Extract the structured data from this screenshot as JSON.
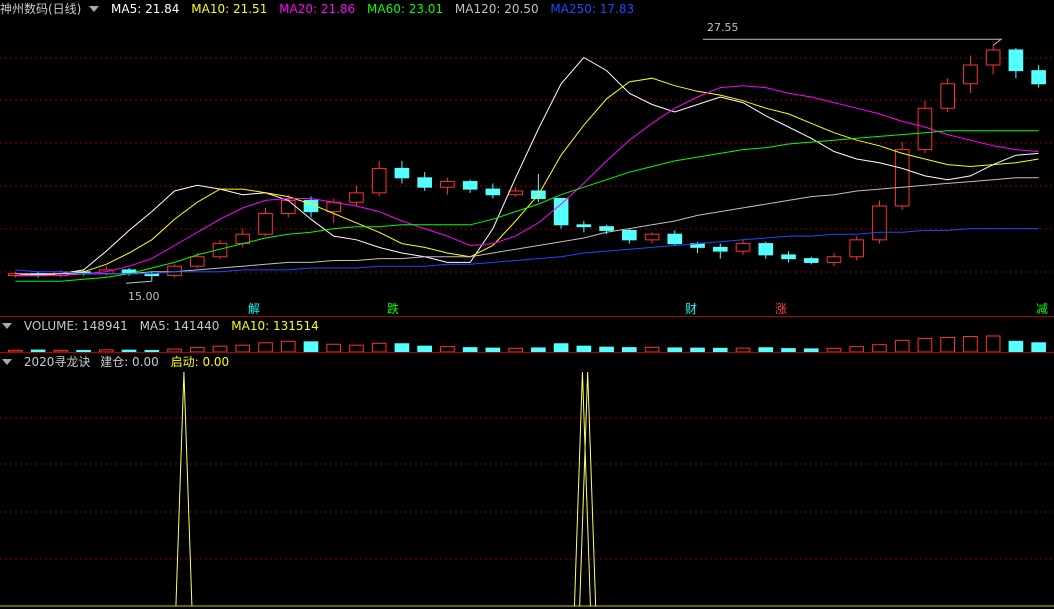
{
  "main": {
    "title": "神州数码(日线)",
    "ma": [
      {
        "label": "MA5: 21.84",
        "color": "#ffffff"
      },
      {
        "label": "MA10: 21.51",
        "color": "#ffff00"
      },
      {
        "label": "MA20: 21.86",
        "color": "#ff00ff"
      },
      {
        "label": "MA60: 23.01",
        "color": "#00ff00"
      },
      {
        "label": "MA120: 20.50",
        "color": "#c0c0c0"
      },
      {
        "label": "MA250: 17.83",
        "color": "#1a4bff"
      }
    ],
    "high_label": "27.55",
    "low_label": "15.00",
    "markers": [
      {
        "text": "解",
        "color": "#00ffff"
      },
      {
        "text": "跌",
        "color": "#00ff00"
      },
      {
        "text": "财",
        "color": "#00ffff"
      },
      {
        "text": "涨",
        "color": "#ff4040"
      },
      {
        "text": "减",
        "color": "#00ff00"
      }
    ]
  },
  "volume_panel": {
    "title": "VOLUME: 148941",
    "ma5": "MA5: 141440",
    "ma10": "MA10: 131514"
  },
  "indicator_panel": {
    "title": "2020寻龙诀",
    "jiancang": "建仓: 0.00",
    "qidong": "启动: 0.00"
  },
  "colors": {
    "up": "#ff3232",
    "down": "#54ffff",
    "grid": "#8b0000",
    "sep": "#b00000",
    "text": "#c0c0c0"
  },
  "chart_data": {
    "type": "candlestick",
    "price_range": [
      14,
      29
    ],
    "high": 27.55,
    "low": 15.0,
    "ma_series": [
      {
        "name": "MA5",
        "color": "#ffffff",
        "values": [
          15.3,
          15.4,
          15.4,
          15.6,
          16.6,
          17.7,
          18.7,
          19.8,
          20.1,
          19.9,
          19.6,
          19.7,
          19.3,
          18.3,
          17.4,
          17.2,
          16.8,
          16.5,
          16.3,
          16.0,
          16.0,
          17.8,
          20.5,
          23.1,
          25.5,
          26.9,
          26.2,
          25.0,
          24.4,
          24.0,
          24.4,
          24.8,
          24.5,
          23.8,
          23.2,
          22.6,
          21.9,
          21.5,
          21.3,
          21.0,
          20.6,
          20.4,
          20.6,
          21.2,
          21.7,
          21.8
        ]
      },
      {
        "name": "MA10",
        "color": "#ffff00",
        "values": [
          15.3,
          15.3,
          15.4,
          15.5,
          15.9,
          16.5,
          17.2,
          18.3,
          19.2,
          19.9,
          19.9,
          19.7,
          19.5,
          19.1,
          18.6,
          18.1,
          17.6,
          17.0,
          16.8,
          16.5,
          16.3,
          16.9,
          18.2,
          19.6,
          21.7,
          23.3,
          24.7,
          25.6,
          25.8,
          25.4,
          25.1,
          24.9,
          24.6,
          24.2,
          23.9,
          23.4,
          22.9,
          22.5,
          22.2,
          21.8,
          21.5,
          21.2,
          21.1,
          21.2,
          21.3,
          21.5
        ]
      },
      {
        "name": "MA20",
        "color": "#ff00ff",
        "values": [
          15.3,
          15.3,
          15.3,
          15.4,
          15.5,
          15.8,
          16.2,
          16.9,
          17.6,
          18.3,
          18.9,
          19.3,
          19.4,
          19.4,
          19.2,
          19.0,
          18.7,
          18.2,
          17.8,
          17.4,
          16.9,
          17.0,
          17.4,
          18.1,
          19.1,
          20.2,
          21.4,
          22.5,
          23.4,
          24.2,
          24.8,
          25.3,
          25.4,
          25.3,
          25.0,
          24.8,
          24.5,
          24.2,
          23.9,
          23.5,
          23.2,
          22.8,
          22.5,
          22.2,
          22.0,
          21.9
        ]
      },
      {
        "name": "MA60",
        "color": "#00ff00",
        "values": [
          15.0,
          15.0,
          15.0,
          15.1,
          15.2,
          15.4,
          15.7,
          16.0,
          16.4,
          16.7,
          17.0,
          17.3,
          17.5,
          17.6,
          17.8,
          17.9,
          17.9,
          18.0,
          18.0,
          18.0,
          18.0,
          18.3,
          18.7,
          19.1,
          19.6,
          20.0,
          20.4,
          20.8,
          21.1,
          21.4,
          21.6,
          21.8,
          22.0,
          22.1,
          22.3,
          22.4,
          22.5,
          22.6,
          22.7,
          22.8,
          22.9,
          23.0,
          23.0,
          23.0,
          23.0,
          23.0
        ]
      },
      {
        "name": "MA120",
        "color": "#c0c0c0",
        "values": [
          15.4,
          15.4,
          15.4,
          15.4,
          15.4,
          15.4,
          15.5,
          15.5,
          15.6,
          15.7,
          15.8,
          15.9,
          16.0,
          16.0,
          16.1,
          16.1,
          16.2,
          16.2,
          16.3,
          16.3,
          16.3,
          16.5,
          16.7,
          16.9,
          17.1,
          17.3,
          17.6,
          17.8,
          18.0,
          18.2,
          18.5,
          18.7,
          18.9,
          19.1,
          19.3,
          19.5,
          19.6,
          19.8,
          19.9,
          20.0,
          20.1,
          20.2,
          20.3,
          20.4,
          20.5,
          20.5
        ]
      },
      {
        "name": "MA250",
        "color": "#1a4bff",
        "values": [
          15.6,
          15.5,
          15.5,
          15.4,
          15.4,
          15.4,
          15.4,
          15.5,
          15.5,
          15.5,
          15.6,
          15.6,
          15.6,
          15.7,
          15.7,
          15.7,
          15.8,
          15.8,
          15.8,
          15.9,
          15.9,
          16.0,
          16.1,
          16.2,
          16.3,
          16.5,
          16.6,
          16.7,
          16.8,
          16.9,
          17.0,
          17.1,
          17.2,
          17.3,
          17.4,
          17.4,
          17.5,
          17.5,
          17.6,
          17.6,
          17.7,
          17.7,
          17.8,
          17.8,
          17.8,
          17.8
        ]
      }
    ],
    "candles": [
      [
        15.3,
        15.4,
        15.2,
        15.5
      ],
      [
        15.4,
        15.3,
        15.2,
        15.5
      ],
      [
        15.3,
        15.5,
        15.2,
        15.6
      ],
      [
        15.5,
        15.4,
        15.3,
        15.6
      ],
      [
        15.4,
        15.6,
        15.3,
        15.8
      ],
      [
        15.6,
        15.4,
        15.3,
        15.7
      ],
      [
        15.4,
        15.3,
        15.0,
        15.5
      ],
      [
        15.3,
        15.8,
        15.2,
        15.9
      ],
      [
        15.8,
        16.3,
        15.7,
        16.5
      ],
      [
        16.3,
        17.0,
        16.2,
        17.2
      ],
      [
        17.0,
        17.5,
        16.8,
        17.8
      ],
      [
        17.5,
        18.6,
        17.4,
        18.9
      ],
      [
        18.6,
        19.3,
        18.4,
        19.6
      ],
      [
        19.3,
        18.7,
        18.4,
        19.5
      ],
      [
        18.7,
        19.2,
        18.1,
        19.4
      ],
      [
        19.2,
        19.7,
        19.0,
        20.1
      ],
      [
        19.7,
        21.0,
        19.5,
        21.4
      ],
      [
        21.0,
        20.5,
        20.2,
        21.4
      ],
      [
        20.5,
        20.0,
        19.8,
        20.8
      ],
      [
        20.0,
        20.3,
        19.6,
        20.5
      ],
      [
        20.3,
        19.9,
        19.7,
        20.4
      ],
      [
        19.9,
        19.6,
        19.4,
        20.2
      ],
      [
        19.6,
        19.8,
        19.5,
        20.0
      ],
      [
        19.8,
        19.4,
        19.2,
        20.7
      ],
      [
        19.4,
        18.0,
        17.8,
        19.4
      ],
      [
        18.0,
        17.9,
        17.6,
        18.2
      ],
      [
        17.9,
        17.7,
        17.5,
        18.0
      ],
      [
        17.7,
        17.2,
        17.0,
        17.8
      ],
      [
        17.2,
        17.5,
        17.0,
        17.6
      ],
      [
        17.5,
        17.0,
        16.9,
        17.7
      ],
      [
        17.0,
        16.8,
        16.5,
        17.1
      ],
      [
        16.8,
        16.6,
        16.2,
        17.0
      ],
      [
        16.6,
        17.0,
        16.4,
        17.2
      ],
      [
        17.0,
        16.4,
        16.2,
        17.1
      ],
      [
        16.4,
        16.2,
        16.0,
        16.6
      ],
      [
        16.2,
        16.0,
        15.9,
        16.3
      ],
      [
        16.0,
        16.3,
        15.8,
        16.5
      ],
      [
        16.3,
        17.2,
        16.1,
        17.4
      ],
      [
        17.2,
        19.0,
        17.0,
        19.3
      ],
      [
        19.0,
        22.0,
        18.8,
        22.4
      ],
      [
        22.0,
        24.2,
        21.8,
        24.6
      ],
      [
        24.2,
        25.5,
        24.0,
        25.8
      ],
      [
        25.5,
        26.5,
        25.0,
        27.0
      ],
      [
        26.5,
        27.3,
        26.0,
        27.55
      ],
      [
        27.3,
        26.2,
        25.8,
        27.4
      ],
      [
        26.2,
        25.5,
        25.3,
        26.5
      ]
    ],
    "volume": [
      18,
      20,
      17,
      16,
      22,
      19,
      15,
      30,
      45,
      60,
      70,
      95,
      110,
      105,
      80,
      70,
      90,
      85,
      60,
      55,
      45,
      40,
      38,
      42,
      85,
      60,
      50,
      45,
      48,
      42,
      40,
      38,
      40,
      44,
      35,
      32,
      38,
      55,
      75,
      120,
      140,
      150,
      160,
      165,
      110,
      95
    ],
    "indicator_peaks": [
      {
        "position": 0.172,
        "value": 1
      },
      {
        "position": 0.553,
        "value": 1
      },
      {
        "position": 0.558,
        "value": 1
      }
    ]
  }
}
